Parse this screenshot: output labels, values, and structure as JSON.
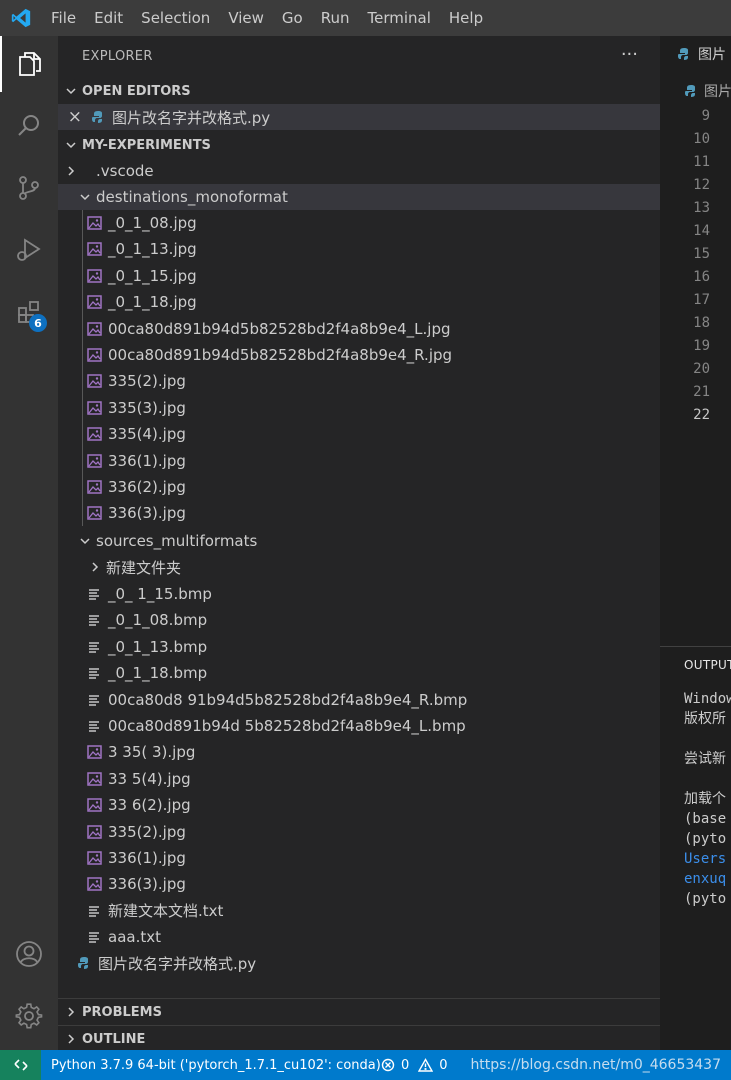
{
  "menu": [
    "File",
    "Edit",
    "Selection",
    "View",
    "Go",
    "Run",
    "Terminal",
    "Help"
  ],
  "activity": {
    "extensions_badge": "6"
  },
  "sidebar": {
    "header": "EXPLORER",
    "more": "···",
    "open_editors": {
      "title": "OPEN EDITORS",
      "close": "×",
      "file": "图片改名字并改格式.py"
    },
    "workspace": {
      "title": "MY-EXPERIMENTS",
      "folders": [
        {
          "name": ".vscode"
        },
        {
          "name": "destinations_monoformat"
        },
        {
          "name": "sources_multiformats"
        },
        {
          "name": "新建文件夹"
        }
      ],
      "dest_files": [
        "_0_1_08.jpg",
        "_0_1_13.jpg",
        "_0_1_15.jpg",
        "_0_1_18.jpg",
        "00ca80d891b94d5b82528bd2f4a8b9e4_L.jpg",
        "00ca80d891b94d5b82528bd2f4a8b9e4_R.jpg",
        "335(2).jpg",
        "335(3).jpg",
        "335(4).jpg",
        "336(1).jpg",
        "336(2).jpg",
        "336(3).jpg"
      ],
      "src_files": [
        {
          "name": "_0_ 1_15.bmp",
          "type": "file"
        },
        {
          "name": "_0_1_08.bmp",
          "type": "file"
        },
        {
          "name": "_0_1_13.bmp",
          "type": "file"
        },
        {
          "name": "_0_1_18.bmp",
          "type": "file"
        },
        {
          "name": "00ca80d8  91b94d5b82528bd2f4a8b9e4_R.bmp",
          "type": "file"
        },
        {
          "name": "00ca80d891b94d  5b82528bd2f4a8b9e4_L.bmp",
          "type": "file"
        },
        {
          "name": "3 35( 3).jpg",
          "type": "image"
        },
        {
          "name": "33 5(4).jpg",
          "type": "image"
        },
        {
          "name": "33 6(2).jpg",
          "type": "image"
        },
        {
          "name": "335(2).jpg",
          "type": "image"
        },
        {
          "name": "336(1).jpg",
          "type": "image"
        },
        {
          "name": "336(3).jpg",
          "type": "image"
        },
        {
          "name": "新建文本文档.txt",
          "type": "file"
        },
        {
          "name": "aaa.txt",
          "type": "file"
        }
      ],
      "root_file": "图片改名字并改格式.py"
    },
    "problems": "PROBLEMS",
    "outline": "OUTLINE"
  },
  "editor": {
    "tab_label": "图片",
    "breadcrumb": "图片",
    "line_numbers": [
      "9",
      "10",
      "11",
      "12",
      "13",
      "14",
      "15",
      "16",
      "17",
      "18",
      "19",
      "20",
      "21",
      "22"
    ],
    "current_line": "22"
  },
  "panel": {
    "title": "OUTPUT",
    "lines": [
      "Window",
      "版权所",
      "",
      "尝试新",
      "",
      "加载个",
      "(base",
      "(pyto",
      "Users",
      "enxuq",
      "(pyto"
    ]
  },
  "status": {
    "python": "Python 3.7.9 64-bit ('pytorch_1.7.1_cu102': conda)",
    "errors": "0",
    "warnings": "0",
    "watermark": "https://blog.csdn.net/m0_46653437"
  },
  "colors": {
    "accent": "#007acc",
    "remote": "#16825d",
    "python_icon": "#519aba",
    "image_icon": "#a074c4"
  }
}
